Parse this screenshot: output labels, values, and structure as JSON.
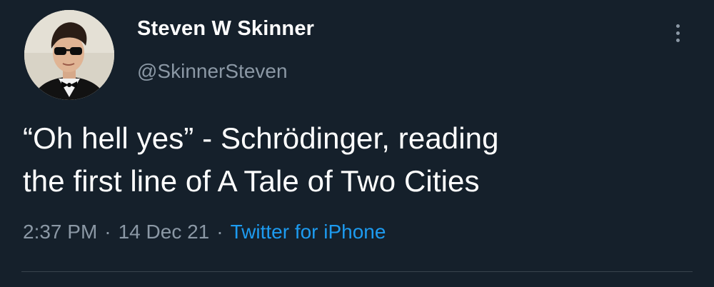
{
  "author": {
    "display_name": "Steven W Skinner",
    "handle": "@SkinnerSteven",
    "avatar_icon": "profile-photo"
  },
  "tweet": {
    "text_line_1": "“Oh hell yes” - Schrödinger, reading",
    "text_line_2": "the first line of A Tale of Two Cities"
  },
  "meta": {
    "time": "2:37 PM",
    "separator": "·",
    "date": "14 Dec 21",
    "source": "Twitter for iPhone"
  },
  "icons": {
    "more": "more-options-icon"
  },
  "colors": {
    "background": "#15202b",
    "text_primary": "#ffffff",
    "text_secondary": "#8b98a5",
    "link": "#1d9bf0"
  }
}
